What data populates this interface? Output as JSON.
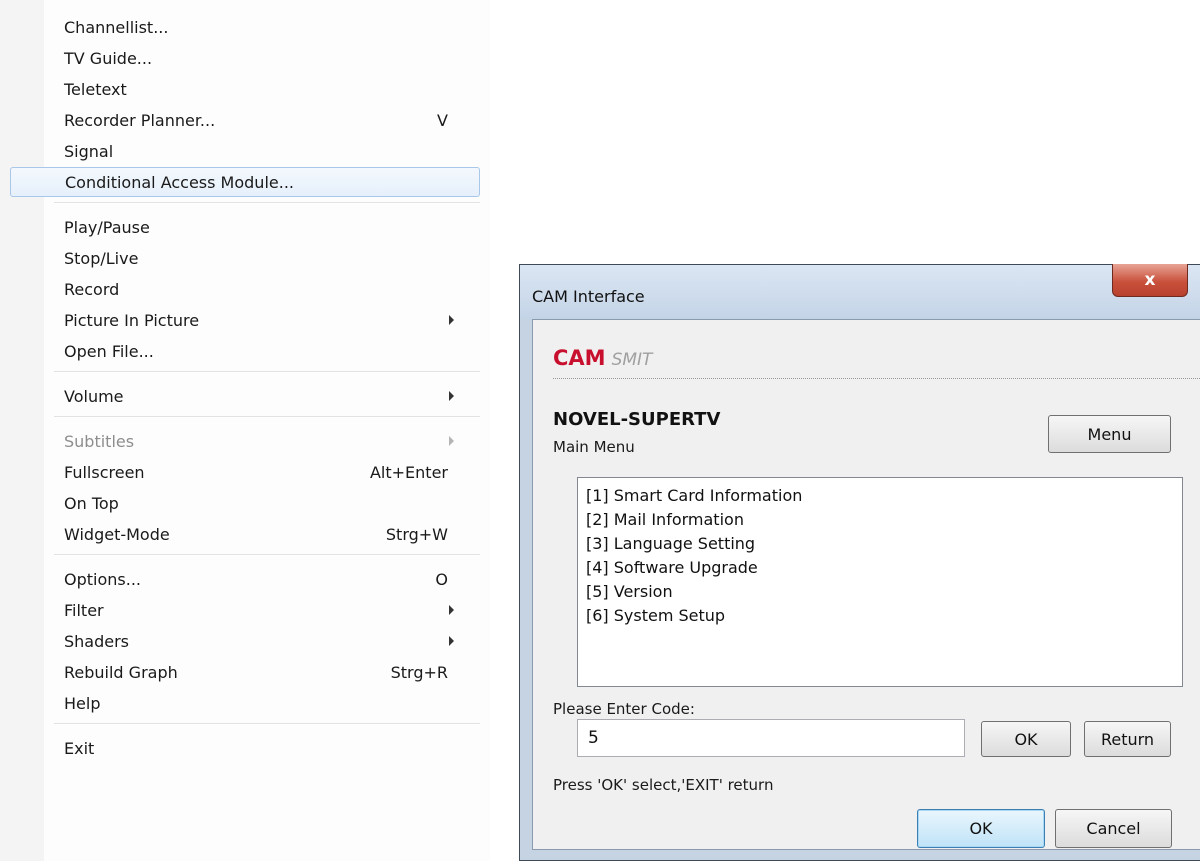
{
  "context_menu": {
    "items": [
      {
        "label": "Channellist...",
        "shortcut": "",
        "submenu": false,
        "disabled": false,
        "highlighted": false,
        "sep_after": false
      },
      {
        "label": "TV Guide...",
        "shortcut": "",
        "submenu": false,
        "disabled": false,
        "highlighted": false,
        "sep_after": false
      },
      {
        "label": "Teletext",
        "shortcut": "",
        "submenu": false,
        "disabled": false,
        "highlighted": false,
        "sep_after": false
      },
      {
        "label": "Recorder Planner...",
        "shortcut": "V",
        "submenu": false,
        "disabled": false,
        "highlighted": false,
        "sep_after": false
      },
      {
        "label": "Signal",
        "shortcut": "",
        "submenu": false,
        "disabled": false,
        "highlighted": false,
        "sep_after": false
      },
      {
        "label": "Conditional Access Module...",
        "shortcut": "",
        "submenu": false,
        "disabled": false,
        "highlighted": true,
        "sep_after": true
      },
      {
        "label": "Play/Pause",
        "shortcut": "",
        "submenu": false,
        "disabled": false,
        "highlighted": false,
        "sep_after": false
      },
      {
        "label": "Stop/Live",
        "shortcut": "",
        "submenu": false,
        "disabled": false,
        "highlighted": false,
        "sep_after": false
      },
      {
        "label": "Record",
        "shortcut": "",
        "submenu": false,
        "disabled": false,
        "highlighted": false,
        "sep_after": false
      },
      {
        "label": "Picture In Picture",
        "shortcut": "",
        "submenu": true,
        "disabled": false,
        "highlighted": false,
        "sep_after": false
      },
      {
        "label": "Open File...",
        "shortcut": "",
        "submenu": false,
        "disabled": false,
        "highlighted": false,
        "sep_after": true
      },
      {
        "label": "Volume",
        "shortcut": "",
        "submenu": true,
        "disabled": false,
        "highlighted": false,
        "sep_after": true
      },
      {
        "label": "Subtitles",
        "shortcut": "",
        "submenu": true,
        "disabled": true,
        "highlighted": false,
        "sep_after": false
      },
      {
        "label": "Fullscreen",
        "shortcut": "Alt+Enter",
        "submenu": false,
        "disabled": false,
        "highlighted": false,
        "sep_after": false
      },
      {
        "label": "On Top",
        "shortcut": "",
        "submenu": false,
        "disabled": false,
        "highlighted": false,
        "sep_after": false
      },
      {
        "label": "Widget-Mode",
        "shortcut": "Strg+W",
        "submenu": false,
        "disabled": false,
        "highlighted": false,
        "sep_after": true
      },
      {
        "label": "Options...",
        "shortcut": "O",
        "submenu": false,
        "disabled": false,
        "highlighted": false,
        "sep_after": false
      },
      {
        "label": "Filter",
        "shortcut": "",
        "submenu": true,
        "disabled": false,
        "highlighted": false,
        "sep_after": false
      },
      {
        "label": "Shaders",
        "shortcut": "",
        "submenu": true,
        "disabled": false,
        "highlighted": false,
        "sep_after": false
      },
      {
        "label": "Rebuild Graph",
        "shortcut": "Strg+R",
        "submenu": false,
        "disabled": false,
        "highlighted": false,
        "sep_after": false
      },
      {
        "label": "Help",
        "shortcut": "",
        "submenu": false,
        "disabled": false,
        "highlighted": false,
        "sep_after": true
      },
      {
        "label": "Exit",
        "shortcut": "",
        "submenu": false,
        "disabled": false,
        "highlighted": false,
        "sep_after": false
      }
    ]
  },
  "dialog": {
    "title": "CAM Interface",
    "close_label": "x",
    "brand_primary": "CAM",
    "brand_secondary": "SMIT",
    "brand_color": "#c8102e",
    "device_name": "NOVEL-SUPERTV",
    "menu_title": "Main Menu",
    "menu_button": "Menu",
    "list_items": [
      "[1] Smart Card Information",
      "[2] Mail Information",
      "[3] Language Setting",
      "[4] Software Upgrade",
      "[5] Version",
      "[6] System Setup"
    ],
    "code_label": "Please Enter Code:",
    "code_value": "5",
    "code_ok": "OK",
    "code_return": "Return",
    "hint": "Press 'OK' select,'EXIT' return",
    "ok": "OK",
    "cancel": "Cancel"
  }
}
